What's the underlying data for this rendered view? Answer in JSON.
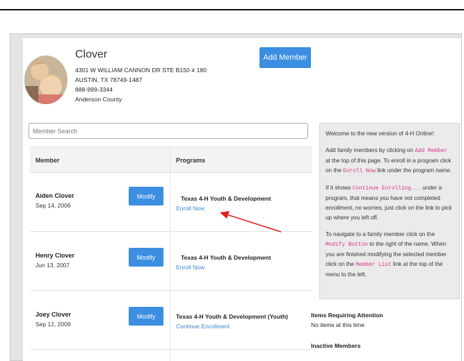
{
  "family": {
    "name": "Clover",
    "address_line1": "4301 W WILLIAM CANNON DR STE B150 # 180",
    "address_line2": "AUSTIN, TX 78749-1487",
    "phone": "888-999-3344",
    "county": "Anderson County",
    "add_member_label": "Add Member"
  },
  "search": {
    "placeholder": "Member Search"
  },
  "table": {
    "col_member": "Member",
    "col_programs": "Programs",
    "rows": [
      {
        "name": "Aiden Clover",
        "dob": "Sep 14, 2006",
        "modify_label": "Modify",
        "program": "Texas 4-H Youth & Development",
        "link": "Enroll Now"
      },
      {
        "name": "Henry Clover",
        "dob": "Jun 13, 2007",
        "modify_label": "Modify",
        "program": "Texas 4-H Youth & Development",
        "link": "Enroll Now"
      },
      {
        "name": "Joey Clover",
        "dob": "Sep 12, 2009",
        "modify_label": "Modify",
        "program": "Texas 4-H Youth & Development (Youth)",
        "link": "Continue Enrollment"
      }
    ]
  },
  "info": {
    "welcome": "Welcome to the new version of 4-H Online!",
    "p1_a": "Add family members by clicking on ",
    "p1_code1": "Add Member",
    "p1_b": " at the top of this page. To enroll in a program click on the ",
    "p1_code2": "Enroll Now",
    "p1_c": " link under the program name.",
    "p2_a": "If it shows ",
    "p2_code": "Continue Enrolling...",
    "p2_b": " under a program, that means you have not completed enrollment, no worries, just click on the link to pick up where you left off.",
    "p3_a": "To navigate to a family member click on the ",
    "p3_code1": "Modify Button",
    "p3_b": " to the right of the name. When you are finished modifying the selected member click on the ",
    "p3_code2": "Member List",
    "p3_c": " link at the top of the menu to the left."
  },
  "attention": {
    "title": "Items Requiring Attention",
    "text": "No items at this time"
  },
  "inactive": {
    "title": "Inactive Members"
  },
  "colors": {
    "accent": "#3b8ee0",
    "link": "#3a87d2",
    "code": "#d9338a",
    "arrow": "#e02020"
  },
  "icons": {
    "family_photo": "family-photo"
  }
}
